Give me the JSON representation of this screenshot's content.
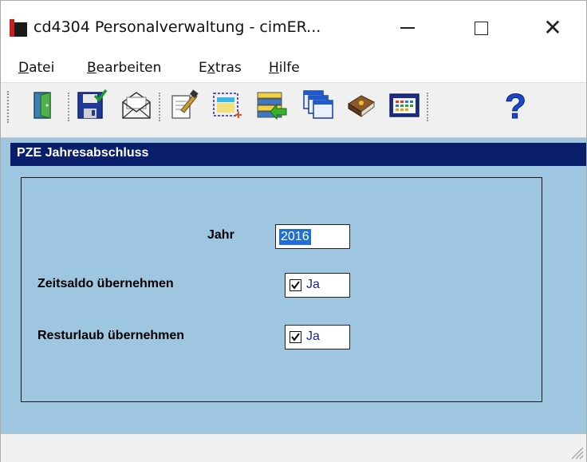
{
  "window": {
    "title": "cd4304 Personalverwaltung - cimER..."
  },
  "menu": {
    "items": [
      {
        "underline": "D",
        "rest": "atei"
      },
      {
        "underline": "B",
        "rest": "earbeiten"
      },
      {
        "pre": "E",
        "underline": "x",
        "rest": "tras"
      },
      {
        "underline": "H",
        "rest": "ilfe"
      }
    ]
  },
  "toolbar": {
    "icons": [
      "exit-door-icon",
      "save-disk-icon",
      "mail-envelope-icon",
      "edit-document-icon",
      "new-record-icon",
      "import-list-icon",
      "windows-cascade-icon",
      "book-icon",
      "calendar-grid-icon",
      "help-question-icon"
    ]
  },
  "section": {
    "title": "PZE Jahresabschluss"
  },
  "form": {
    "jahr_label": "Jahr",
    "jahr_value": "2016",
    "zeitsaldo_label": "Zeitsaldo übernehmen",
    "zeitsaldo_checked": true,
    "zeitsaldo_value": "Ja",
    "resturlaub_label": "Resturlaub übernehmen",
    "resturlaub_checked": true,
    "resturlaub_value": "Ja"
  },
  "colors": {
    "content_bg": "#9ec6e0",
    "header_bg": "#0a1f6b",
    "selection": "#1f6fd6",
    "value_text": "#1a2a9a"
  }
}
